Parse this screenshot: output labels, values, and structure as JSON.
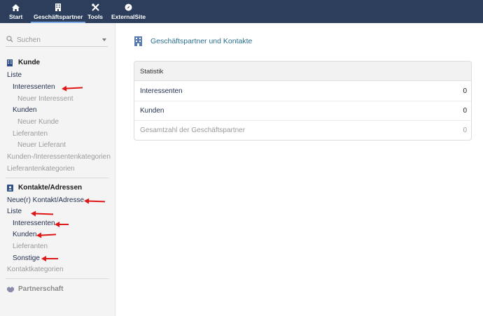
{
  "nav": {
    "items": [
      {
        "label": "Start",
        "icon": "home-icon"
      },
      {
        "label": "Geschäftspartner",
        "icon": "building-icon"
      },
      {
        "label": "Tools",
        "icon": "tools-icon"
      },
      {
        "label": "ExternalSite",
        "icon": "compass-icon"
      }
    ]
  },
  "sidebar": {
    "search_placeholder": "Suchen",
    "kunde": {
      "title": "Kunde",
      "liste": "Liste",
      "interessenten": "Interessenten",
      "neuer_interessent": "Neuer Interessent",
      "kunden": "Kunden",
      "neuer_kunde": "Neuer Kunde",
      "lieferanten": "Lieferanten",
      "neuer_lieferant": "Neuer Lieferant",
      "kunden_kategorien": "Kunden-/Interessentenkategorien",
      "lieferantenkategorien": "Lieferantenkategorien"
    },
    "kontakte": {
      "title": "Kontakte/Adressen",
      "neu": "Neue(r) Kontakt/Adresse",
      "liste": "Liste",
      "interessenten": "Interessenten",
      "kunden": "Kunden",
      "lieferanten": "Lieferanten",
      "sonstige": "Sonstige",
      "kategorien": "Kontaktkategorien"
    },
    "partnerschaft": {
      "title": "Partnerschaft"
    }
  },
  "main": {
    "title": "Geschäftspartner und Kontakte",
    "card_title": "Statistik",
    "rows": [
      {
        "label": "Interessenten",
        "value": "0"
      },
      {
        "label": "Kunden",
        "value": "0"
      },
      {
        "label": "Gesamtzahl der Geschäftspartner",
        "value": "0"
      }
    ]
  },
  "colors": {
    "navbar": "#2c3e5c",
    "accent": "#2a6f8f",
    "annotation": "#e01515"
  }
}
